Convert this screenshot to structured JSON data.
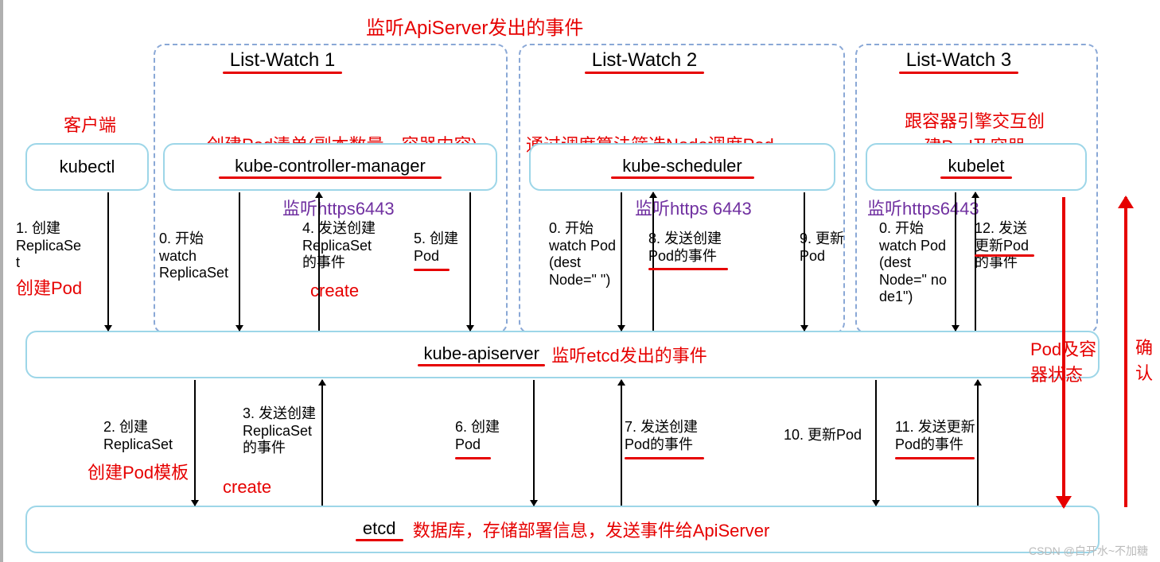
{
  "title_top": "监听ApiServer发出的事件",
  "list_watch": [
    "List-Watch 1",
    "List-Watch 2",
    "List-Watch 3"
  ],
  "client_label": "客户端",
  "kubectl": "kubectl",
  "kcm": {
    "name": "kube-controller-manager",
    "desc": "创建Pod清单(副本数量，容器内容)",
    "listen": "监听https6443"
  },
  "ksched": {
    "name": "kube-scheduler",
    "desc": "通过调度算法筛选Node调度Pod",
    "listen": "监听https 6443"
  },
  "kubelet": {
    "name": "kubelet",
    "desc1": "跟容器引擎交互创",
    "desc2": "建Pod及容器",
    "listen": "监听https6443"
  },
  "apiserver": {
    "name": "kube-apiserver",
    "desc": "监听etcd发出的事件"
  },
  "etcd": {
    "name": "etcd",
    "desc": "数据库，存储部署信息，发送事件给ApiServer"
  },
  "steps": {
    "s0a": "0. 开始\nwatch\nReplicaSet",
    "s0b": "0. 开始\nwatch Pod\n(dest\nNode=\" \")",
    "s0c": "0. 开始\nwatch Pod\n(dest\nNode=\" no\nde1\")",
    "s1": "1. 创建\nReplicaSe\nt",
    "s2": "2. 创建\nReplicaSet",
    "s3": "3. 发送创建\nReplicaSet\n的事件",
    "s4": "4. 发送创建\nReplicaSet\n的事件",
    "s5": "5. 创建\nPod",
    "s6": "6. 创建\nPod",
    "s7": "7. 发送创建\nPod的事件",
    "s8": "8. 发送创建\nPod的事件",
    "s9": "9. 更新\nPod",
    "s10": "10. 更新Pod",
    "s11": "11. 发送更新\nPod的事件",
    "s12": "12. 发送\n更新Pod\n的事件"
  },
  "notes": {
    "create_pod": "创建Pod",
    "create": "create",
    "create_pod_template": "创建Pod模板",
    "pod_status1": "Pod及容",
    "pod_status2": "器状态",
    "confirm1": "确",
    "confirm2": "认"
  },
  "watermark": "CSDN @白开水~不加糖"
}
